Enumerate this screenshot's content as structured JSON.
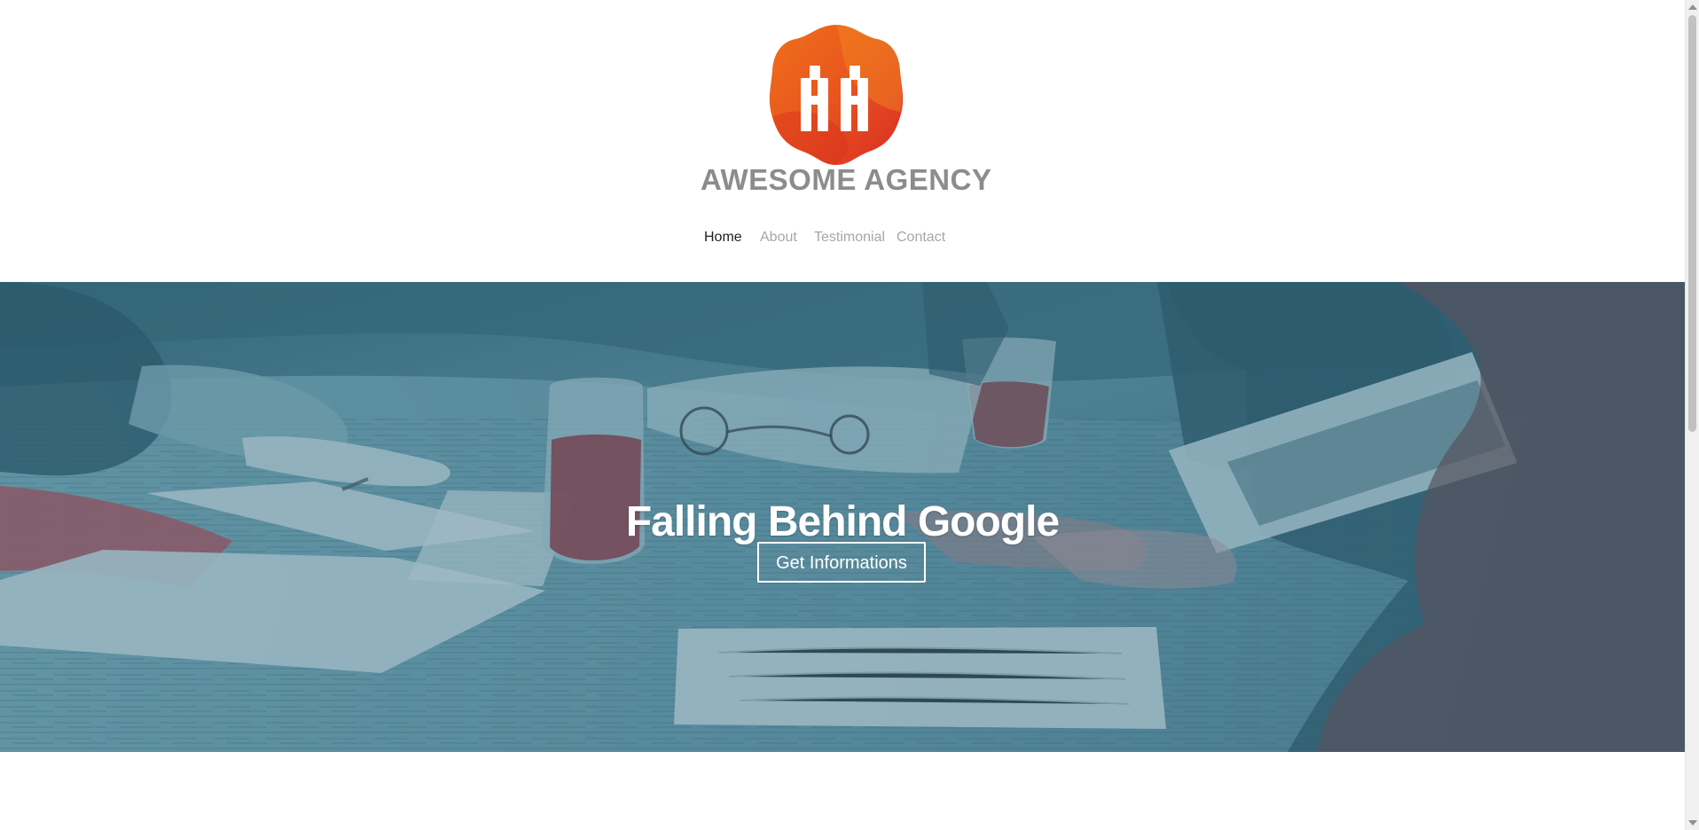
{
  "brand": {
    "logo_icon": "agency-logo-icon",
    "name": "AWESOME AGENCY"
  },
  "nav": {
    "items": [
      {
        "label": "Home",
        "active": true
      },
      {
        "label": "About",
        "active": false
      },
      {
        "label": "Testimonial",
        "active": false
      },
      {
        "label": "Contact",
        "active": false
      }
    ]
  },
  "hero": {
    "title": "Falling Behind Google",
    "button": "Get Informations"
  },
  "colors": {
    "accent_orange": "#e8561e",
    "brand_gray": "#8c8c8c",
    "nav_inactive": "#a6a6a6",
    "nav_active": "#1f1f1f",
    "hero_overlay": "#3f6f7f"
  }
}
